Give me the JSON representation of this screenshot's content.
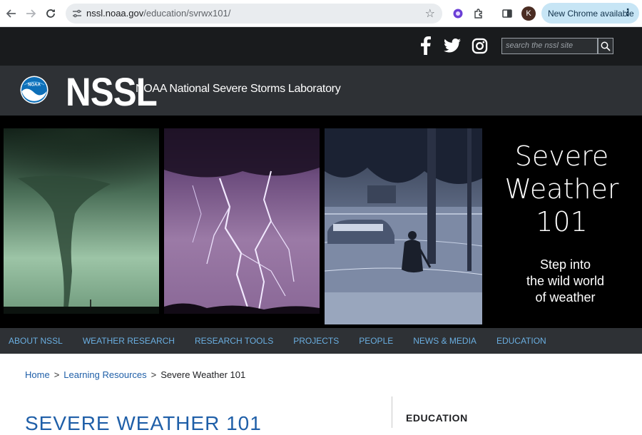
{
  "browser": {
    "url_host": "nssl.noaa.gov",
    "url_path": "/education/svrwx101/",
    "update_label": "New Chrome available",
    "profile_initial": "K"
  },
  "site": {
    "search_placeholder": "search the nssl site",
    "logo_word": "NSSL",
    "logo_full": "NOAA National Severe Storms Laboratory",
    "noaa_badge": "NOAA"
  },
  "hero": {
    "title_line1": "Severe",
    "title_line2": "Weather",
    "title_line3": "101",
    "sub_line1": "Step into",
    "sub_line2": "the wild world",
    "sub_line3": "of weather"
  },
  "nav": {
    "items": [
      "ABOUT NSSL",
      "WEATHER RESEARCH",
      "RESEARCH TOOLS",
      "PROJECTS",
      "PEOPLE",
      "NEWS & MEDIA",
      "EDUCATION"
    ]
  },
  "breadcrumb": {
    "home": "Home",
    "learning": "Learning Resources",
    "current": "Severe Weather 101"
  },
  "page": {
    "title": "SEVERE WEATHER 101",
    "side_heading": "EDUCATION"
  },
  "colors": {
    "link_blue": "#1f5fa8",
    "nav_blue": "#6aaee0",
    "header_gray": "#2e3135",
    "update_pill": "#c7e5f5"
  }
}
